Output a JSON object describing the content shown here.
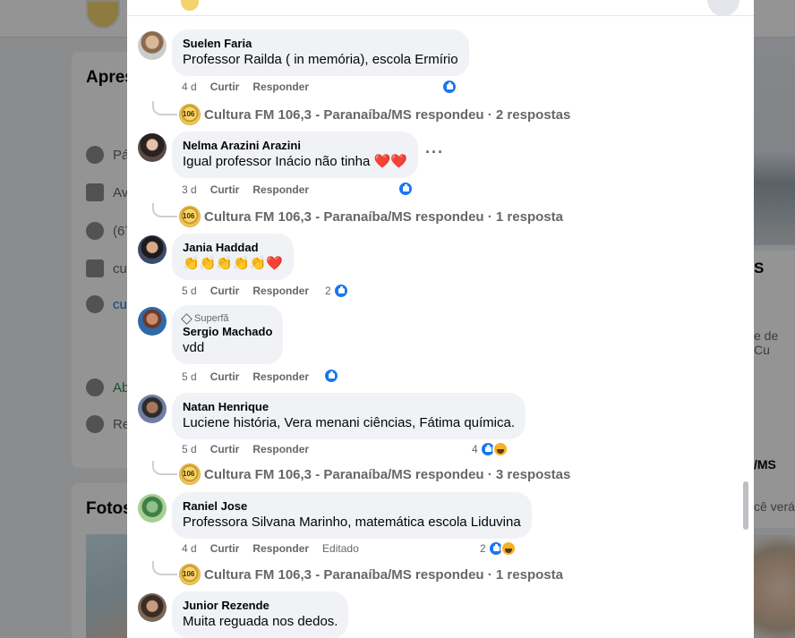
{
  "comments": [
    {
      "author": "Suelen Faria",
      "text": "Professor Railda ( in memória), escola Ermírio",
      "time": "4 d",
      "like_label": "Curtir",
      "reply_label": "Responder",
      "reply_summary": "Cultura FM 106,3 - Paranaíba/MS respondeu · 2 respostas"
    },
    {
      "author": "Nelma Arazini Arazini",
      "text": "Igual professor Inácio não tinha ❤️❤️",
      "time": "3 d",
      "like_label": "Curtir",
      "reply_label": "Responder",
      "more": "···",
      "reply_summary": "Cultura FM 106,3 - Paranaíba/MS respondeu · 1 resposta"
    },
    {
      "author": "Jania Haddad",
      "text": "👏👏👏👏👏❤️",
      "time": "5 d",
      "like_label": "Curtir",
      "reply_label": "Responder",
      "reaction_count": "2"
    },
    {
      "badge": "Superfã",
      "author": "Sergio Machado",
      "text": "vdd",
      "time": "5 d",
      "like_label": "Curtir",
      "reply_label": "Responder"
    },
    {
      "author": "Natan Henrique",
      "text": "Luciene história, Vera menani ciências, Fátima química.",
      "time": "5 d",
      "like_label": "Curtir",
      "reply_label": "Responder",
      "reaction_count": "4",
      "reply_summary": "Cultura FM 106,3 - Paranaíba/MS respondeu · 3 respostas"
    },
    {
      "author": "Raniel Jose",
      "text": "Professora Silvana Marinho, matemática escola Liduvina",
      "time": "4 d",
      "like_label": "Curtir",
      "reply_label": "Responder",
      "edited_label": "Editado",
      "reaction_count": "2",
      "reply_summary": "Cultura FM 106,3 - Paranaíba/MS respondeu · 1 resposta"
    },
    {
      "author": "Junior Rezende",
      "text": "Muita reguada nos dedos."
    }
  ],
  "background": {
    "left_title_1": "Apres",
    "left_title_2": "Fotos",
    "rows": [
      "Pá",
      "Av",
      "(67",
      "cu",
      "cu",
      "Ab",
      "Re"
    ],
    "right_texts": [
      "S",
      "e de Cu",
      "/MS",
      "cê verá"
    ]
  },
  "colors": {
    "like_blue": "#1877f2",
    "bubble_bg": "#f0f2f5",
    "secondary_text": "#65676b"
  }
}
